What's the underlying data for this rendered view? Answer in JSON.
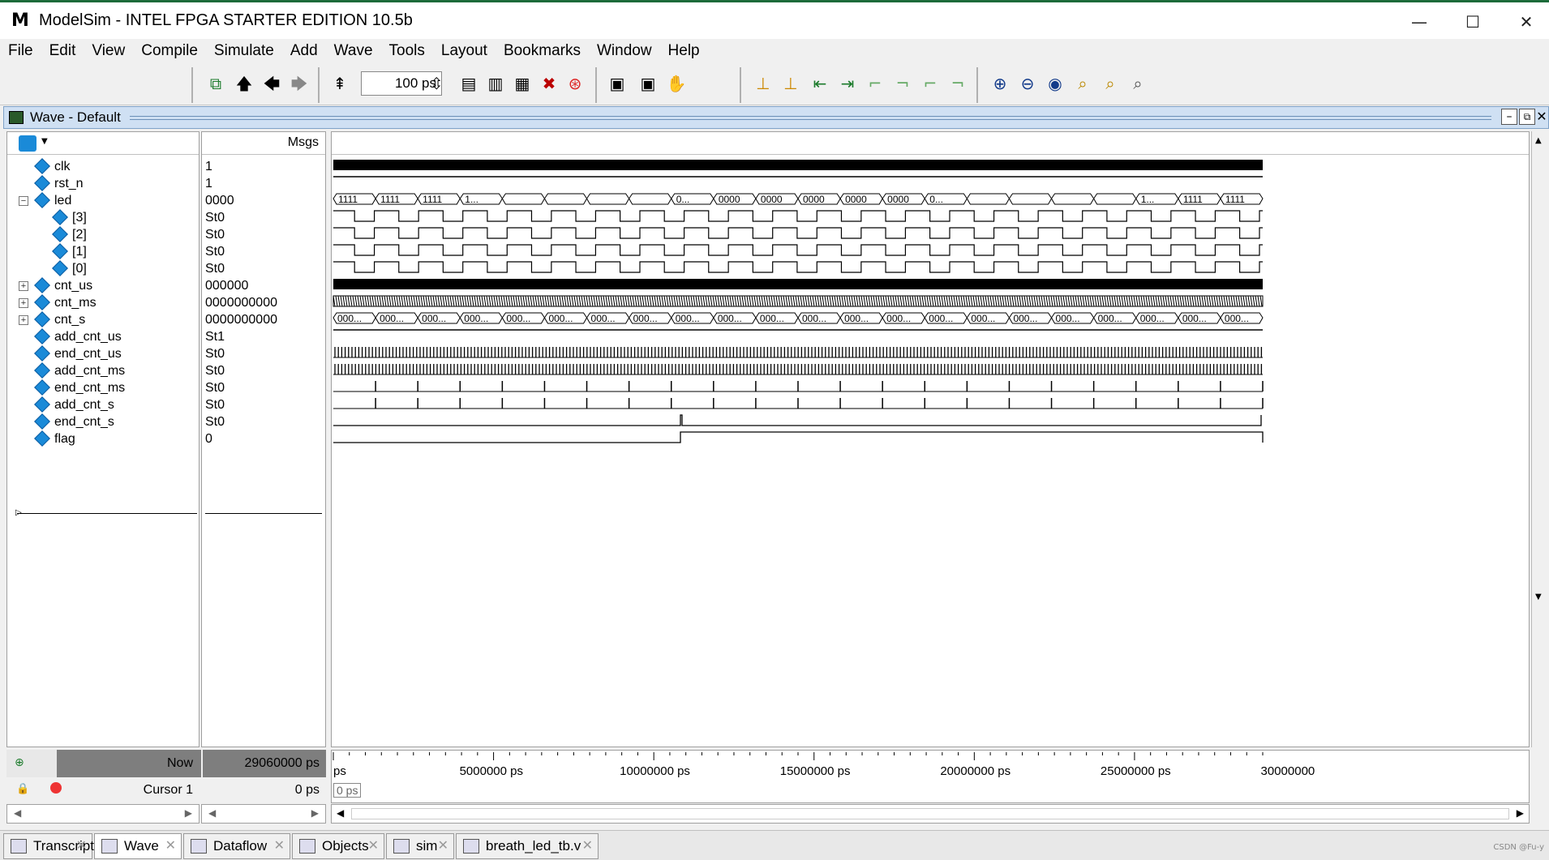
{
  "window": {
    "title": "ModelSim - INTEL FPGA STARTER EDITION 10.5b",
    "controls": [
      "—",
      "☐",
      "✕"
    ]
  },
  "menu": [
    "File",
    "Edit",
    "View",
    "Compile",
    "Simulate",
    "Add",
    "Wave",
    "Tools",
    "Layout",
    "Bookmarks",
    "Window",
    "Help"
  ],
  "toolbar": {
    "zoom_value": "100 ps"
  },
  "wave_panel": {
    "title": "Wave - Default",
    "msgs_label": "Msgs"
  },
  "signals": [
    {
      "name": "clk",
      "value": "1",
      "indent": 0,
      "expander": ""
    },
    {
      "name": "rst_n",
      "value": "1",
      "indent": 0,
      "expander": ""
    },
    {
      "name": "led",
      "value": "0000",
      "indent": 0,
      "expander": "−"
    },
    {
      "name": "[3]",
      "value": "St0",
      "indent": 1,
      "expander": ""
    },
    {
      "name": "[2]",
      "value": "St0",
      "indent": 1,
      "expander": ""
    },
    {
      "name": "[1]",
      "value": "St0",
      "indent": 1,
      "expander": ""
    },
    {
      "name": "[0]",
      "value": "St0",
      "indent": 1,
      "expander": ""
    },
    {
      "name": "cnt_us",
      "value": "000000",
      "indent": 0,
      "expander": "+"
    },
    {
      "name": "cnt_ms",
      "value": "0000000000",
      "indent": 0,
      "expander": "+"
    },
    {
      "name": "cnt_s",
      "value": "0000000000",
      "indent": 0,
      "expander": "+"
    },
    {
      "name": "add_cnt_us",
      "value": "St1",
      "indent": 0,
      "expander": ""
    },
    {
      "name": "end_cnt_us",
      "value": "St0",
      "indent": 0,
      "expander": ""
    },
    {
      "name": "add_cnt_ms",
      "value": "St0",
      "indent": 0,
      "expander": ""
    },
    {
      "name": "end_cnt_ms",
      "value": "St0",
      "indent": 0,
      "expander": ""
    },
    {
      "name": "add_cnt_s",
      "value": "St0",
      "indent": 0,
      "expander": ""
    },
    {
      "name": "end_cnt_s",
      "value": "St0",
      "indent": 0,
      "expander": ""
    },
    {
      "name": "flag",
      "value": "0",
      "indent": 0,
      "expander": ""
    }
  ],
  "led_bus_labels": [
    "1111",
    "1111",
    "1111",
    "1...",
    "0...",
    "0000",
    "0000",
    "0000",
    "0000",
    "0000",
    "0...",
    "1...",
    "1111",
    "1111"
  ],
  "cnt_s_label": "000...",
  "status": {
    "now_label": "Now",
    "now_value": "29060000 ps",
    "cursor_label": "Cursor 1",
    "cursor_value": "0 ps",
    "cursor_marker": "0 ps"
  },
  "timeline": {
    "ticks": [
      "ps",
      "5000000 ps",
      "10000000 ps",
      "15000000 ps",
      "20000000 ps",
      "25000000 ps",
      "30000000"
    ]
  },
  "tabs": [
    {
      "label": "Transcript",
      "active": false
    },
    {
      "label": "Wave",
      "active": true
    },
    {
      "label": "Dataflow",
      "active": false
    },
    {
      "label": "Objects",
      "active": false
    },
    {
      "label": "sim",
      "active": false
    },
    {
      "label": "breath_led_tb.v",
      "active": false
    }
  ],
  "watermark": "CSDN @Fu-y"
}
